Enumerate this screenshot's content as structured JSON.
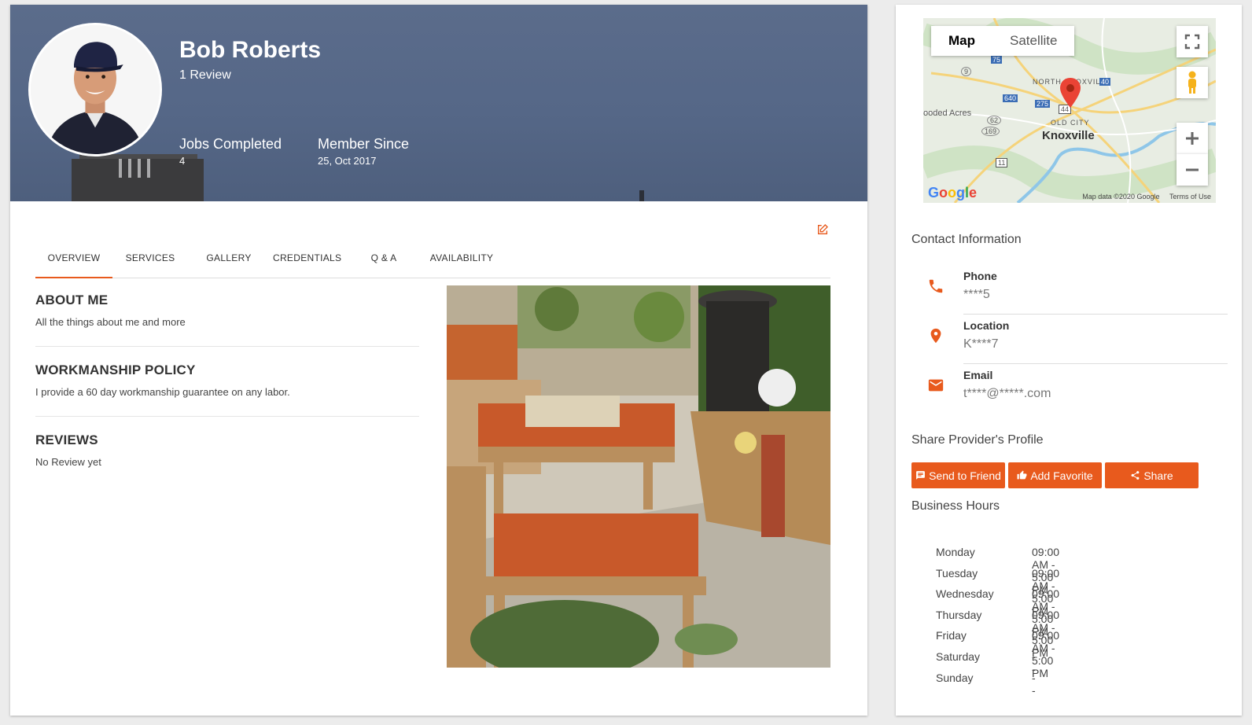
{
  "profile": {
    "name": "Bob Roberts",
    "review_count": "1 Review",
    "stats": [
      {
        "label": "Jobs Completed",
        "value": "4"
      },
      {
        "label": "Member Since",
        "value": "25, Oct 2017"
      }
    ]
  },
  "tabs": [
    "OVERVIEW",
    "SERVICES",
    "GALLERY",
    "CREDENTIALS",
    "Q & A",
    "AVAILABILITY"
  ],
  "active_tab": "OVERVIEW",
  "sections": [
    {
      "title": "ABOUT ME",
      "text": "All the things about me and more"
    },
    {
      "title": "WORKMANSHIP POLICY",
      "text": "I provide a 60 day workmanship guarantee on any labor."
    },
    {
      "title": "REVIEWS",
      "text": "No Review yet"
    }
  ],
  "map": {
    "map_label": "Map",
    "satellite_label": "Satellite",
    "city": "Knoxville",
    "labels": {
      "north_knoxville": "NORTH KNOXVILLE",
      "old_city": "OLD CITY",
      "wooded_acres": "ooded Acres"
    },
    "road_numbers": [
      "75",
      "9",
      "640",
      "275",
      "40",
      "62",
      "169",
      "44",
      "11"
    ],
    "logo": "Google",
    "footer_data": "Map data ©2020 Google",
    "footer_terms": "Terms of Use",
    "icons": [
      "fullscreen-icon",
      "pegman-icon",
      "zoom-in-icon",
      "zoom-out-icon",
      "map-pin-icon"
    ]
  },
  "contact": {
    "heading": "Contact Information",
    "items": [
      {
        "label": "Phone",
        "value": "****5",
        "icon": "phone-icon"
      },
      {
        "label": "Location",
        "value": "K****7",
        "icon": "location-pin-icon"
      },
      {
        "label": "Email",
        "value": "t****@*****.com",
        "icon": "email-icon"
      }
    ]
  },
  "share": {
    "heading": "Share Provider's Profile",
    "buttons": [
      {
        "label": "Send to Friend",
        "icon": "message-icon"
      },
      {
        "label": "Add Favorite",
        "icon": "thumbs-up-icon"
      },
      {
        "label": "Share",
        "icon": "share-icon"
      }
    ]
  },
  "business_hours": {
    "heading": "Business Hours",
    "rows": [
      {
        "day": "Monday",
        "hours": "09:00 AM - 5:00 PM"
      },
      {
        "day": "Tuesday",
        "hours": "09:00 AM - 5:00 PM"
      },
      {
        "day": "Wednesday",
        "hours": "09:00 AM - 5:00 PM"
      },
      {
        "day": "Thursday",
        "hours": "09:00 AM - 5:00 PM"
      },
      {
        "day": "Friday",
        "hours": "09:00 AM - 5:00 PM"
      },
      {
        "day": "Saturday",
        "hours": "--"
      },
      {
        "day": "Sunday",
        "hours": "--"
      }
    ]
  },
  "colors": {
    "accent": "#e85a1d",
    "hero": "#556787"
  }
}
